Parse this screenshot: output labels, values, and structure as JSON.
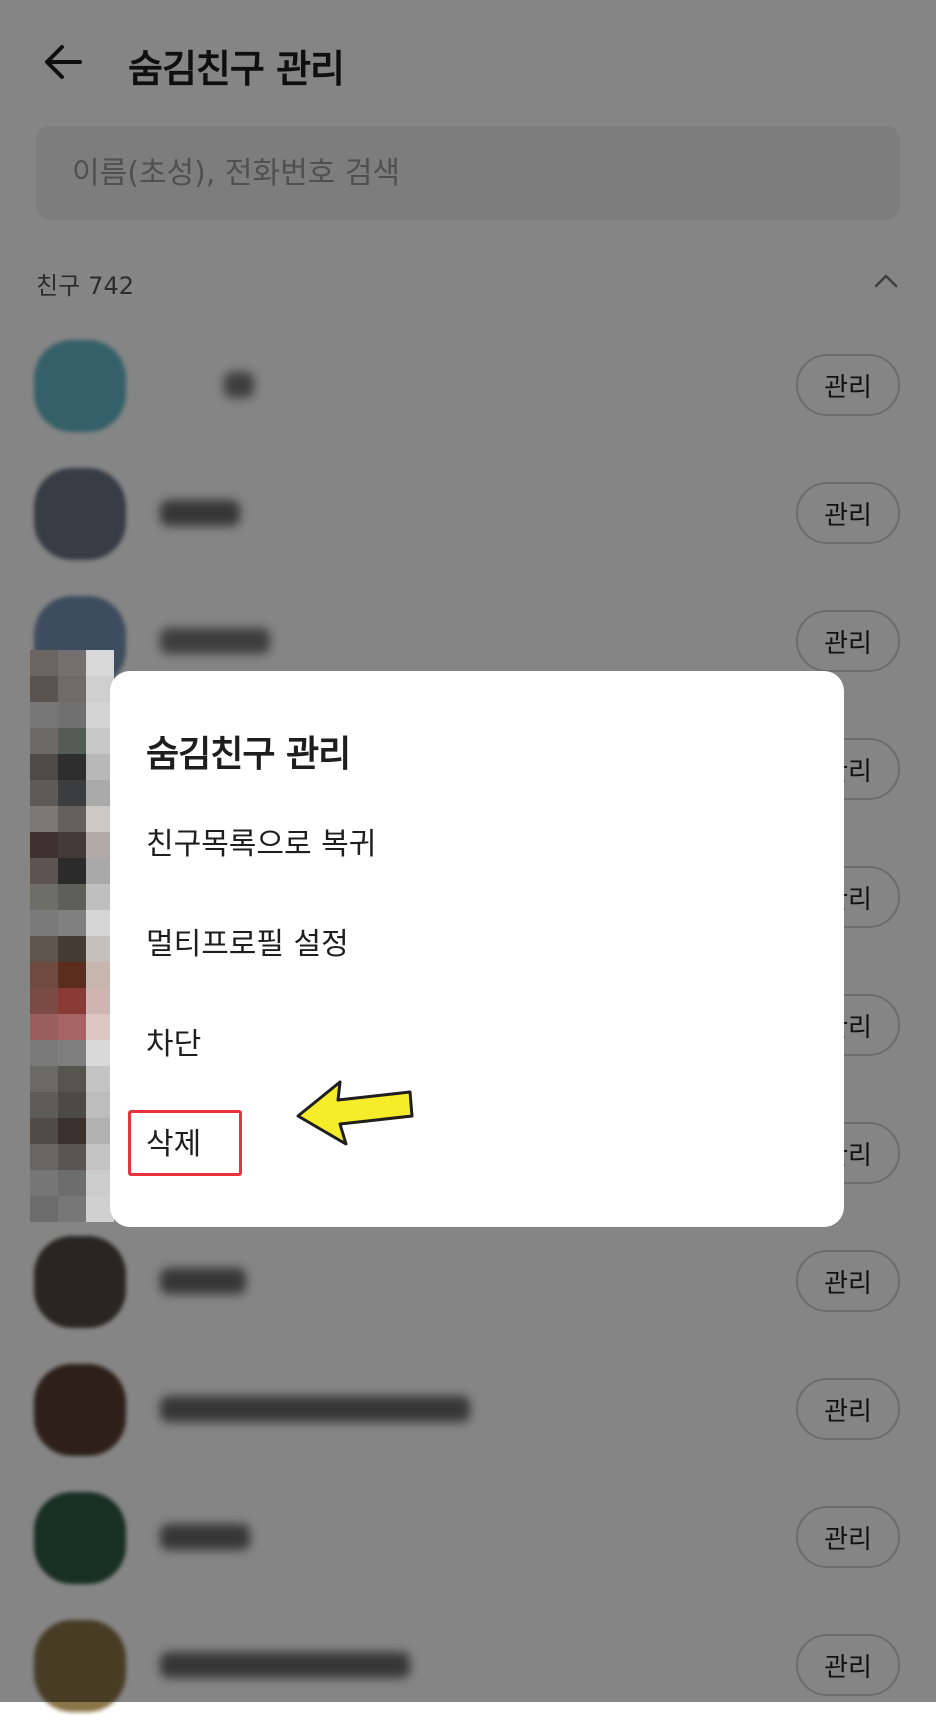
{
  "header": {
    "title": "숨김친구 관리",
    "back_icon": "arrow-left-icon"
  },
  "search": {
    "placeholder": "이름(초성), 전화번호 검색"
  },
  "section": {
    "label": "친구",
    "count": "742",
    "collapse_icon": "chevron-up-icon"
  },
  "friends": [
    {
      "manage_label": "관리"
    },
    {
      "manage_label": "관리"
    },
    {
      "manage_label": "관리"
    },
    {
      "manage_label": "관리"
    },
    {
      "manage_label": "관리"
    },
    {
      "manage_label": "관리"
    },
    {
      "manage_label": "관리"
    },
    {
      "manage_label": "관리"
    },
    {
      "manage_label": "관리"
    },
    {
      "manage_label": "관리"
    },
    {
      "manage_label": "관리"
    }
  ],
  "dialog": {
    "title": "숨김친구 관리",
    "items": [
      {
        "label": "친구목록으로 복귀"
      },
      {
        "label": "멀티프로필 설정"
      },
      {
        "label": "차단"
      },
      {
        "label": "삭제"
      }
    ]
  },
  "annotation": {
    "highlight_color": "#e8323c",
    "arrow_color": "#f5ec2a"
  }
}
